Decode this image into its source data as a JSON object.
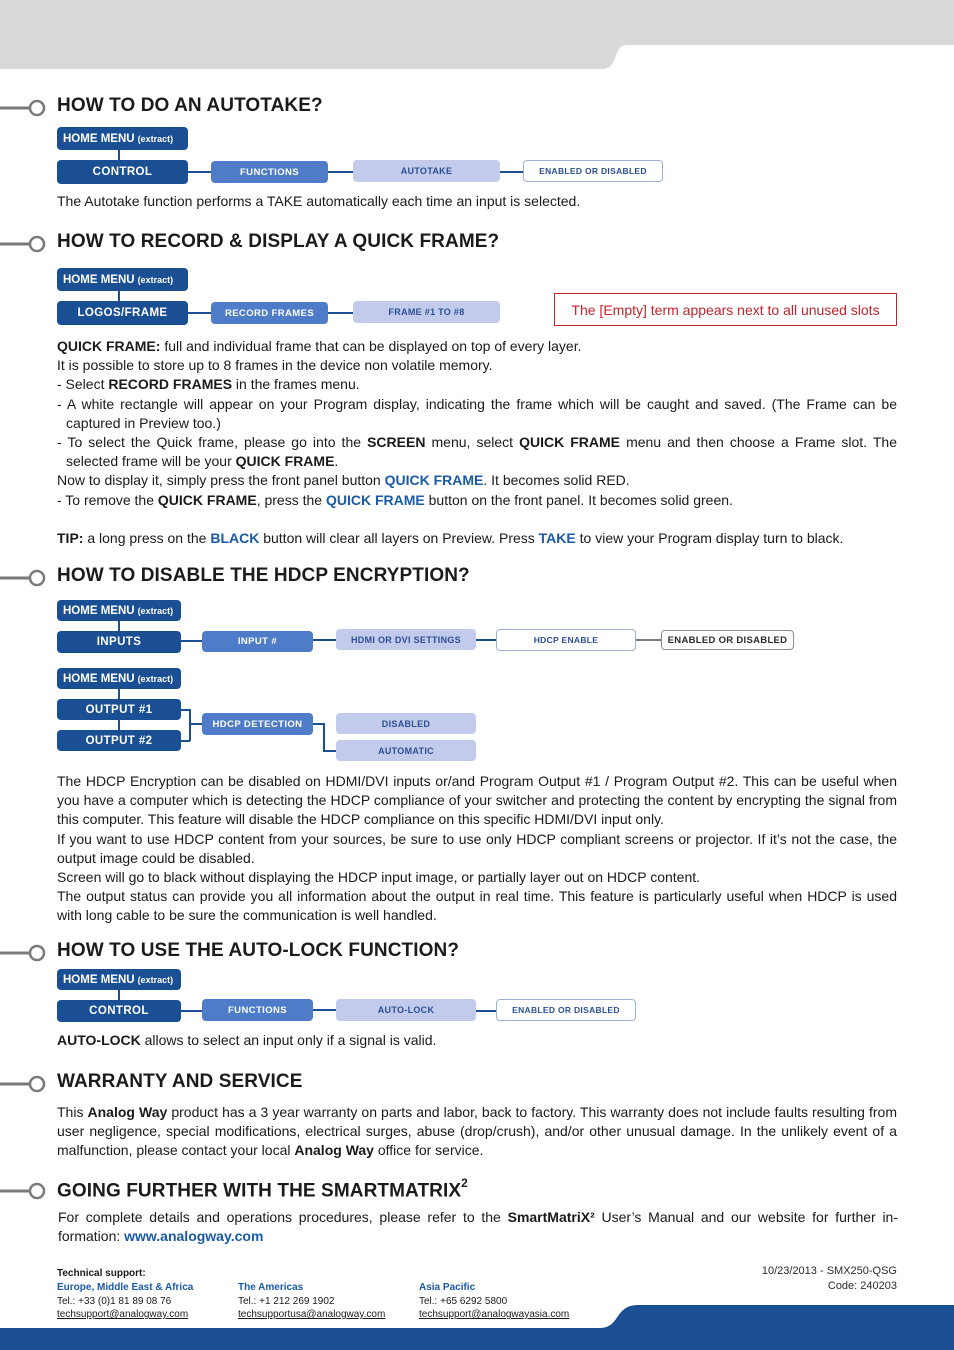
{
  "colors": {
    "brand_blue": "#1a4f93",
    "mid_blue": "#4f7cc9",
    "light_blue": "#c2cbeb",
    "link_blue": "#1a5aa6",
    "note_red": "#c0242c",
    "band_grey": "#d9d9d9"
  },
  "sections": {
    "autotake": {
      "title": "HOW TO DO AN AUTOTAKE?",
      "home_menu": "HOME MENU",
      "extract": "(extract)",
      "path": [
        "CONTROL",
        "FUNCTIONS",
        "AUTOTAKE",
        "ENABLED OR DISABLED"
      ],
      "body": "The Autotake function performs a TAKE automatically each time an input is selected."
    },
    "quick_frame": {
      "title": "HOW TO RECORD & DISPLAY A QUICK FRAME?",
      "home_menu": "HOME MENU",
      "extract": "(extract)",
      "path": [
        "LOGOS/FRAME",
        "RECORD FRAMES",
        "FRAME #1 TO #8"
      ],
      "note": "The [Empty] term appears next to all unused slots",
      "p1_bold": "QUICK FRAME:",
      "p1_rest": " full and individual frame that can be displayed on top of every layer.",
      "p2": "It is possible to store up to 8 frames in the device non volatile memory.",
      "p3_a": "- Select ",
      "p3_bold": "RECORD FRAMES",
      "p3_b": " in the frames menu.",
      "p4": "- A white rectangle will appear on your Program display, indicating the frame which will be caught and saved. (The Frame can be captured in Preview too.)",
      "p5_a": "- To select the Quick frame, please go into the ",
      "p5_b1": "SCREEN",
      "p5_b": " menu, select ",
      "p5_b2": "QUICK FRAME",
      "p5_c": " menu and then choose a Frame slot. The selected frame will be your ",
      "p5_b3": "QUICK FRAME",
      "p5_d": ".",
      "p6_a": "Now to display it, simply press the front panel button ",
      "p6_blue": "QUICK FRAME",
      "p6_b": ". It becomes solid RED.",
      "p7_a": "- To remove the ",
      "p7_bold": "QUICK FRAME",
      "p7_b": ", press the ",
      "p7_blue": "QUICK FRAME",
      "p7_c": " button on the front panel. It becomes solid green.",
      "tip_label": "TIP:",
      "tip_a": " a long press on the ",
      "tip_black": "BLACK",
      "tip_b": " button will clear all layers on Preview. Press ",
      "tip_take": "TAKE",
      "tip_c": " to view your Program display turn to black."
    },
    "hdcp": {
      "title": "HOW TO DISABLE THE HDCP ENCRYPTION?",
      "home_menu": "HOME MENU",
      "extract": "(extract)",
      "path1": [
        "INPUTS",
        "INPUT #",
        "HDMI OR DVI SETTINGS",
        "HDCP ENABLE",
        "ENABLED OR DISABLED"
      ],
      "outputs": [
        "OUTPUT #1",
        "OUTPUT #2"
      ],
      "detection": "HDCP DETECTION",
      "options": [
        "DISABLED",
        "AUTOMATIC"
      ],
      "body": [
        "The HDCP Encryption can be disabled on HDMI/DVI inputs or/and Program Output #1 / Program Output #2. This can be useful when you have a computer which is detecting the HDCP compliance of your switcher and protecting the content by encrypting the signal from this computer. This feature will disable the HDCP compliance on this specific HDMI/DVI input only.",
        "If you want to use HDCP content from your sources, be sure to use only HDCP compliant screens or projector. If it’s not the case, the output image could be disabled.",
        "Screen will go to black without displaying the HDCP input image, or partially layer out on HDCP content.",
        "The output status can provide you all information about the output in real time. This feature is particularly useful when HDCP is used with long cable to be sure the communication is well handled."
      ]
    },
    "autolock": {
      "title": "HOW TO USE THE AUTO-LOCK FUNCTION?",
      "home_menu": "HOME MENU",
      "extract": "(extract)",
      "path": [
        "CONTROL",
        "FUNCTIONS",
        "AUTO-LOCK",
        "ENABLED OR DISABLED"
      ],
      "body_bold": "AUTO-LOCK",
      "body_rest": " allows to select an input only if a signal is valid."
    },
    "warranty": {
      "title": "WARRANTY AND SERVICE",
      "a": "This ",
      "brand1": "Analog Way",
      "b": " product has a 3 year warranty on parts and labor, back to factory. This warranty does not include faults resulting from user negligence, special modifications, electrical surges, abuse (drop/crush), and/or other unusual damage. In the unlikely event of a malfunction, please contact your local ",
      "brand2": "Analog Way",
      "c": " office for service."
    },
    "further": {
      "title": "GOING FURTHER WITH THE SMARTMATRIX",
      "title_sup": "2",
      "a": "For complete details and operations procedures, please refer to the ",
      "product": "SmartMatriX²",
      "b": " User’s Manual and our website for further in-formation: ",
      "link": "www.analogway.com"
    }
  },
  "footer": {
    "heading": "Technical support:",
    "regions": [
      {
        "name": "Europe, Middle East & Africa",
        "tel": "Tel.: +33 (0)1 81 89 08 76",
        "email": "techsupport@analogway.com"
      },
      {
        "name": "The Americas",
        "tel": "Tel.: +1 212 269 1902",
        "email": "techsupportusa@analogway.com"
      },
      {
        "name": "Asia Pacific",
        "tel": "Tel.: +65 6292 5800",
        "email": "techsupport@analogwayasia.com"
      }
    ],
    "doc_ref": "10/23/2013 - SMX250-QSG",
    "code": "Code: 240203"
  }
}
